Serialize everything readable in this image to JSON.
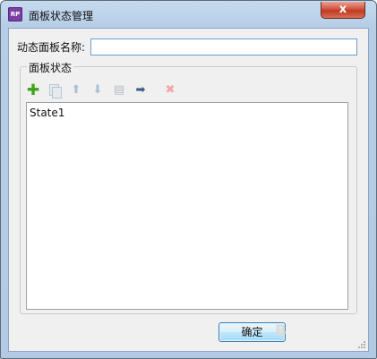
{
  "window": {
    "title": "面板状态管理",
    "app_icon_text": "RP",
    "close_label": "x"
  },
  "form": {
    "name_label": "动态面板名称:",
    "name_value": ""
  },
  "group": {
    "title": "面板状态",
    "toolbar": {
      "add": "add-icon",
      "duplicate": "duplicate-icon",
      "move_up": "move-up-icon",
      "move_down": "move-down-icon",
      "edit": "edit-icon",
      "move_to": "move-to-icon",
      "delete": "delete-icon"
    },
    "states": [
      "State1"
    ]
  },
  "buttons": {
    "ok": "确定"
  },
  "watermark": "B",
  "colors": {
    "title_bar": "#b9d1ea",
    "close_button": "#c94a32",
    "add_icon": "#3fa21b",
    "delete_icon": "#f0a6a6",
    "ok_border": "#3c7fb1"
  }
}
